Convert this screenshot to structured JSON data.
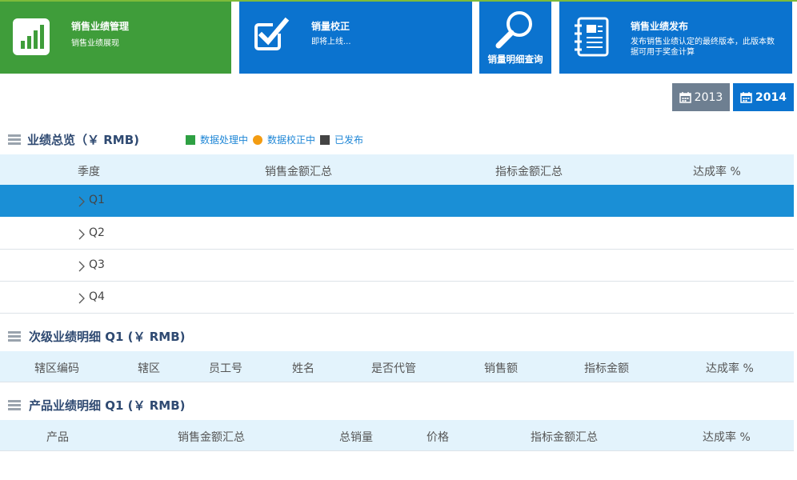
{
  "tiles": {
    "performance": {
      "title": "销售业绩管理",
      "subtitle": "销售业绩展现"
    },
    "verify": {
      "title": "销量校正",
      "subtitle": "即将上线..."
    },
    "detail": {
      "title": "销量明细查询"
    },
    "publish": {
      "title": "销售业绩发布",
      "subtitle": "发布销售业绩认定的最终版本，此版本数据可用于奖金计算"
    }
  },
  "years": {
    "y2013": "2013",
    "y2014": "2014",
    "selected": "2014"
  },
  "overview": {
    "title": "业绩总览（￥ RMB)",
    "legend": [
      {
        "label": "数据处理中",
        "color": "#2ea043"
      },
      {
        "label": "数据校正中",
        "color": "#f39c12"
      },
      {
        "label": "已发布",
        "color": "#444444"
      }
    ],
    "columns": [
      "季度",
      "销售金额汇总",
      "指标金额汇总",
      "达成率 %"
    ],
    "rows": [
      "Q1",
      "Q2",
      "Q3",
      "Q4"
    ],
    "selected_row": "Q1"
  },
  "subordinate": {
    "title": "次级业绩明细 Q1 (￥ RMB)",
    "columns": [
      "辖区编码",
      "辖区",
      "员工号",
      "姓名",
      "是否代管",
      "销售额",
      "指标金额",
      "达成率 %"
    ]
  },
  "product": {
    "title": "产品业绩明细 Q1 (￥ RMB)",
    "columns": [
      "产品",
      "销售金额汇总",
      "总销量",
      "价格",
      "指标金额汇总",
      "达成率 %"
    ]
  }
}
